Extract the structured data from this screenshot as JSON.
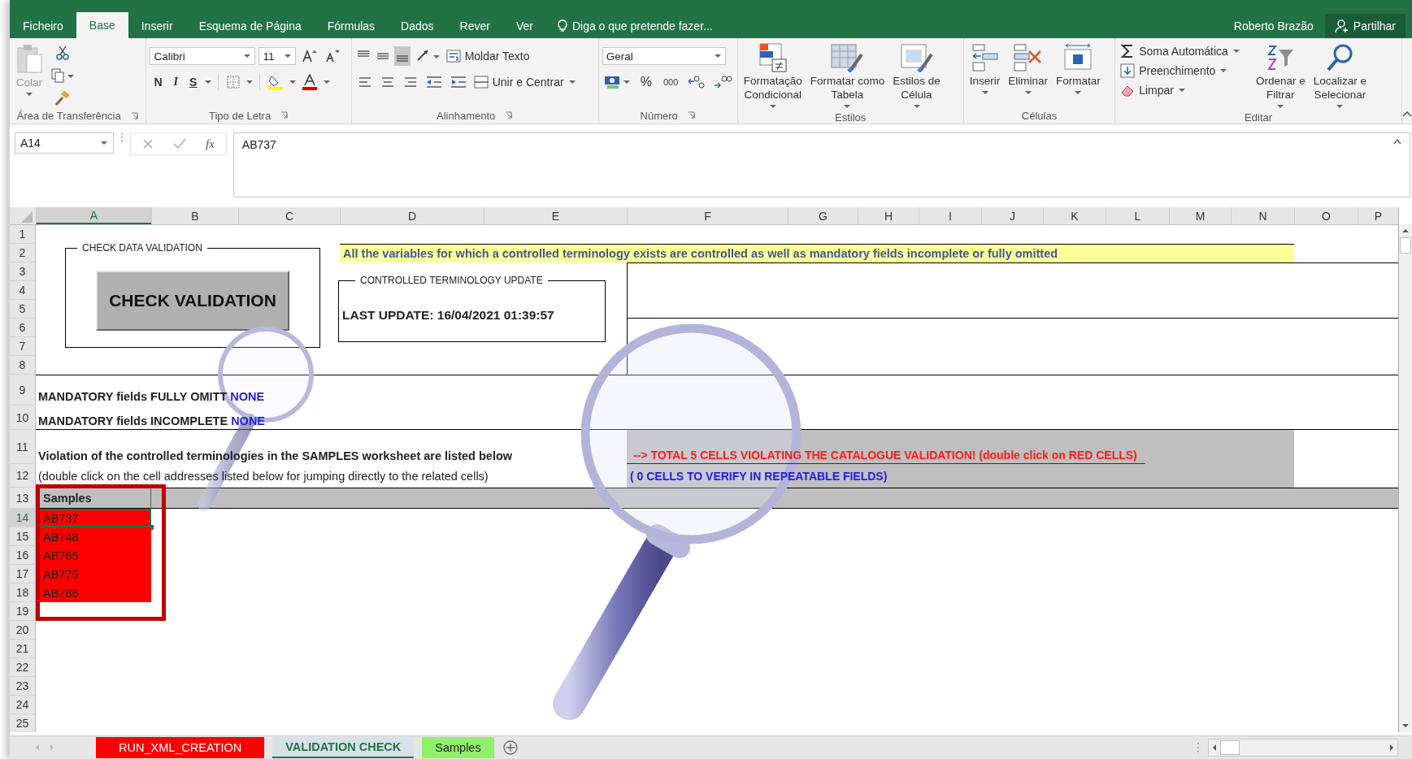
{
  "ribbon_tabs": [
    {
      "label": "Ficheiro",
      "selected": false
    },
    {
      "label": "Base",
      "selected": true
    },
    {
      "label": "Inserir",
      "selected": false
    },
    {
      "label": "Esquema de Página",
      "selected": false
    },
    {
      "label": "Fórmulas",
      "selected": false
    },
    {
      "label": "Dados",
      "selected": false
    },
    {
      "label": "Rever",
      "selected": false
    },
    {
      "label": "Ver",
      "selected": false
    }
  ],
  "tell_me": "Diga o que pretende fazer...",
  "user": "Roberto Brazão",
  "share": "Partilhar",
  "ribbon_groups": [
    {
      "kind": "clipboard",
      "label": "Área de Transferência",
      "paste": "Colar",
      "paste_disabled": true
    },
    {
      "kind": "font",
      "label": "Tipo de Letra",
      "font": "Calibri",
      "size": "11",
      "styles": [
        "N",
        "I",
        "S"
      ]
    },
    {
      "kind": "alignment",
      "label": "Alinhamento",
      "valign": [
        {
          "selected": false
        },
        {
          "selected": false
        },
        {
          "selected": true
        }
      ],
      "buttons": [
        "Moldar Texto",
        "Unir e Centrar"
      ]
    },
    {
      "kind": "number",
      "label": "Número",
      "format": "Geral",
      "symbols": [
        "%",
        "000"
      ]
    },
    {
      "kind": "styles",
      "label": "Estilos",
      "buttons": [
        [
          "Formatação",
          "Condicional"
        ],
        [
          "Formatar como",
          "Tabela"
        ],
        [
          "Estilos de",
          "Célula"
        ]
      ]
    },
    {
      "kind": "cells",
      "label": "Células",
      "buttons": [
        "Inserir",
        "Eliminar",
        "Formatar"
      ]
    },
    {
      "kind": "editing",
      "label": "Editar",
      "small": [
        "Soma Automática",
        "Preenchimento",
        "Limpar"
      ],
      "large": [
        [
          "Ordenar e",
          "Filtrar"
        ],
        [
          "Localizar e",
          "Selecionar"
        ]
      ]
    }
  ],
  "formula_bar": {
    "name_box": "A14",
    "fx": "fx",
    "value": "AB737"
  },
  "columns": [
    {
      "label": "A",
      "selected": true
    },
    {
      "label": "B",
      "selected": false
    },
    {
      "label": "C",
      "selected": false
    },
    {
      "label": "D",
      "selected": false
    },
    {
      "label": "E",
      "selected": false
    },
    {
      "label": "F",
      "selected": false
    },
    {
      "label": "G",
      "selected": false
    },
    {
      "label": "H",
      "selected": false
    },
    {
      "label": "I",
      "selected": false
    },
    {
      "label": "J",
      "selected": false
    },
    {
      "label": "K",
      "selected": false
    },
    {
      "label": "L",
      "selected": false
    },
    {
      "label": "M",
      "selected": false
    },
    {
      "label": "N",
      "selected": false
    },
    {
      "label": "O",
      "selected": false
    },
    {
      "label": "P",
      "selected": false
    }
  ],
  "rows": [
    {
      "label": "1",
      "selected": false
    },
    {
      "label": "2",
      "selected": false
    },
    {
      "label": "3",
      "selected": false
    },
    {
      "label": "4",
      "selected": false
    },
    {
      "label": "5",
      "selected": false
    },
    {
      "label": "6",
      "selected": false
    },
    {
      "label": "7",
      "selected": false
    },
    {
      "label": "8",
      "selected": false
    },
    {
      "label": "9",
      "selected": false
    },
    {
      "label": "10",
      "selected": false
    },
    {
      "label": "11",
      "selected": false
    },
    {
      "label": "12",
      "selected": false
    },
    {
      "label": "13",
      "selected": false
    },
    {
      "label": "14",
      "selected": true
    },
    {
      "label": "15",
      "selected": false
    },
    {
      "label": "16",
      "selected": false
    },
    {
      "label": "17",
      "selected": false
    },
    {
      "label": "18",
      "selected": false
    },
    {
      "label": "19",
      "selected": false
    },
    {
      "label": "20",
      "selected": false
    },
    {
      "label": "21",
      "selected": false
    },
    {
      "label": "22",
      "selected": false
    },
    {
      "label": "23",
      "selected": false
    },
    {
      "label": "24",
      "selected": false
    },
    {
      "label": "25",
      "selected": false
    }
  ],
  "sheet": {
    "check_panel": {
      "title": "CHECK DATA VALIDATION",
      "button": "CHECK VALIDATION"
    },
    "banner": "All the variables for which a controlled terminology exists are controlled as well as mandatory fields incomplete or fully omitted",
    "update_panel": {
      "title": "CONTROLLED TERMINOLOGY UPDATE",
      "text": "LAST UPDATE: 16/04/2021 01:39:57"
    },
    "mandatory": [
      {
        "label": "MANDATORY fields FULLY OMITT",
        "value": "NONE"
      },
      {
        "label": "MANDATORY fields INCOMPLETE",
        "value": "NONE"
      }
    ],
    "violation_title": "Violation of the controlled terminologies in the SAMPLES worksheet are listed below",
    "violation_hint": "(double click on the cell addresses listed below for jumping directly to the related cells)",
    "total_message": "--> TOTAL 5 CELLS VIOLATING THE CATALOGUE VALIDATION! (double click on RED CELLS)",
    "repeatable_message": "( 0 CELLS TO VERIFY IN REPEATABLE FIELDS)",
    "list_header": "Samples",
    "cells": [
      {
        "value": "AB737",
        "invalid": true,
        "selected": true
      },
      {
        "value": "AB748",
        "invalid": true,
        "selected": false
      },
      {
        "value": "AB765",
        "invalid": true,
        "selected": false
      },
      {
        "value": "AB775",
        "invalid": true,
        "selected": false
      },
      {
        "value": "AB786",
        "invalid": true,
        "selected": false
      }
    ]
  },
  "sheet_tabs": [
    {
      "label": "RUN_XML_CREATION",
      "color": "#ff0000",
      "selected": false
    },
    {
      "label": "VALIDATION CHECK",
      "color": "#d9e1e8",
      "selected": true
    },
    {
      "label": "Samples",
      "color": "#92f06a",
      "selected": false
    }
  ]
}
